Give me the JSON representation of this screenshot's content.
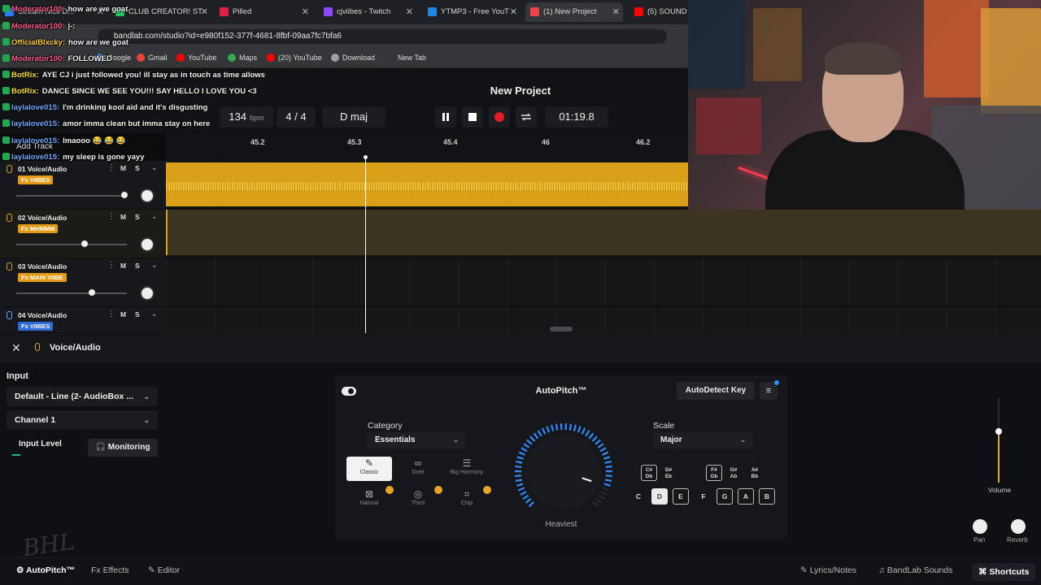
{
  "browser": {
    "tabs": [
      {
        "label": "Stream Nick D...",
        "color": "#2b7bff"
      },
      {
        "label": "CLUB CREATOR! ST",
        "color": "#22c55e"
      },
      {
        "label": "Pilled",
        "color": "#e11d48"
      },
      {
        "label": "cjviibes - Twitch",
        "color": "#9146ff"
      },
      {
        "label": "YTMP3 - Free YouT",
        "color": "#1e88e5"
      },
      {
        "label": "(1) New Project",
        "color": "#ef4444"
      },
      {
        "label": "(5) SOUND EI",
        "color": "#ff0000"
      }
    ],
    "url": "bandlab.com/studio?id=e980f152-377f-4681-8fbf-09aa7fc7bfa6",
    "bookmarks": [
      {
        "label": "Google",
        "color": "#4285f4"
      },
      {
        "label": "Gmail",
        "color": "#ea4335"
      },
      {
        "label": "YouTube",
        "color": "#ff0000"
      },
      {
        "label": "Maps",
        "color": "#34a853"
      },
      {
        "label": "(20) YouTube",
        "color": "#ff0000"
      },
      {
        "label": "Download",
        "color": "#9aa0a6"
      },
      {
        "label": "New Tab",
        "color": "#35363a"
      }
    ]
  },
  "chat": [
    {
      "user": "Moderator100:",
      "msg": "how are we goat",
      "color": "#ff5a8a"
    },
    {
      "user": "Moderator100:",
      "msg": "|-:",
      "color": "#ff5a8a"
    },
    {
      "user": "OfficialBlxcky:",
      "msg": "how are we goat",
      "color": "#ffcc33"
    },
    {
      "user": "Moderator100:",
      "msg": "FOLLOWED",
      "color": "#ff5a8a"
    },
    {
      "user": "BotRix:",
      "msg": "AYE CJ i just followed you! ill stay as in touch as time allows",
      "color": "#ffdd33"
    },
    {
      "user": "BotRix:",
      "msg": "DANCE SINCE WE SEE YOU!!! SAY HELLO I LOVE YOU <3",
      "color": "#ffdd33"
    },
    {
      "user": "laylalove015:",
      "msg": "I'm drinking kool aid and it's disgusting",
      "color": "#6fa8ff"
    },
    {
      "user": "laylalove015:",
      "msg": "amor imma clean but imma stay on here",
      "color": "#6fa8ff"
    },
    {
      "user": "laylalove015:",
      "msg": "lmaooo 😂 😂 😂",
      "color": "#6fa8ff"
    },
    {
      "user": "laylalove015:",
      "msg": "my sleep is gone yayy",
      "color": "#6fa8ff"
    }
  ],
  "app": {
    "project_title": "New Project",
    "bpm": "134",
    "bpm_unit": "bpm",
    "time_signature": "4 / 4",
    "key": "D maj",
    "time": "01:19.8",
    "add_track": "Add Track"
  },
  "ruler": [
    "45.2",
    "45.3",
    "45.4",
    "46",
    "46.2"
  ],
  "tracks": [
    {
      "num": "01",
      "name": "Voice/Audio",
      "fx": "Fx VIIBES",
      "fx_color": "orange",
      "vol": 0.97,
      "m": "M",
      "s": "S"
    },
    {
      "num": "02",
      "name": "Voice/Audio",
      "fx": "Fx MHMMM",
      "fx_color": "orange",
      "vol": 0.62,
      "m": "M",
      "s": "S"
    },
    {
      "num": "03",
      "name": "Voice/Audio",
      "fx": "Fx MAIN VIIBE",
      "fx_color": "orange",
      "vol": 0.68,
      "m": "M",
      "s": "S"
    },
    {
      "num": "04",
      "name": "Voice/Audio",
      "fx": "Fx VIIBES",
      "fx_color": "blue",
      "m": "M",
      "s": "S"
    }
  ],
  "panel": {
    "title": "Voice/Audio",
    "input_label": "Input",
    "input_device": "Default - Line (2- AudioBox ...",
    "channel": "Channel 1",
    "input_level": "Input Level",
    "monitoring": "Monitoring",
    "autopitch": {
      "title": "AutoPitch™",
      "detect_key": "AutoDetect Key",
      "category_label": "Category",
      "category": "Essentials",
      "voices": [
        "Classic",
        "Duet",
        "Big Harmony",
        "Natural",
        "Third",
        "Chip"
      ],
      "selected_voice": "Classic",
      "dial_label": "Heaviest",
      "dial_value": 0.9,
      "scale_label": "Scale",
      "scale": "Major",
      "sharps": [
        "C#\nDb",
        "D#\nEb",
        "F#\nGb",
        "G#\nAb",
        "A#\nBb"
      ],
      "naturals": [
        "C",
        "D",
        "E",
        "F",
        "G",
        "A",
        "B"
      ],
      "selected_key": "D"
    },
    "volume_label": "Volume",
    "volume_level": 0.62,
    "pan_label": "Pan",
    "reverb_label": "Reverb"
  },
  "footer": {
    "autopitch": "AutoPitch™",
    "effects": "Effects",
    "editor": "Editor",
    "lyrics": "Lyrics/Notes",
    "sounds": "BandLab Sounds",
    "shortcuts": "Shortcuts"
  },
  "watermark": "BHL"
}
